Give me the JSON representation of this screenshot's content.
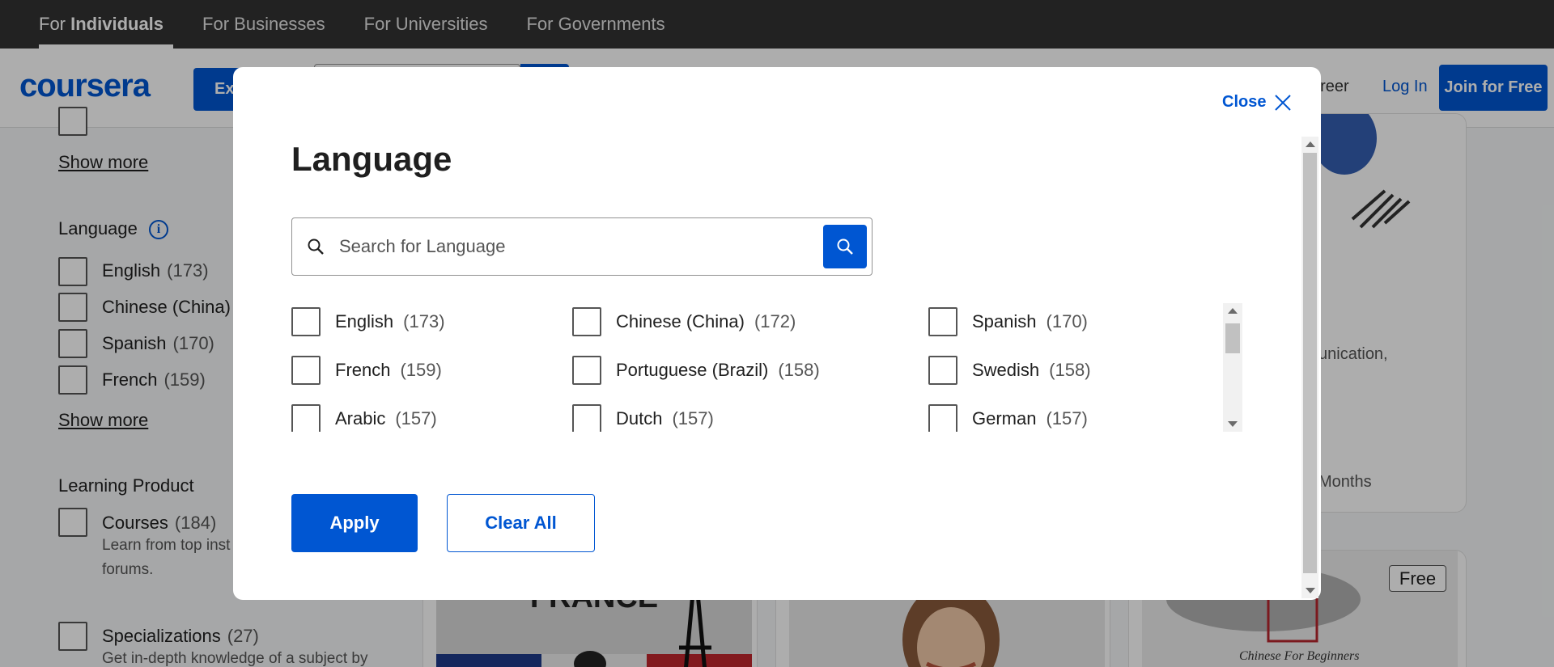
{
  "topbar": {
    "items": [
      {
        "prefix": "For ",
        "label": "Individuals"
      },
      {
        "label": "For Businesses"
      },
      {
        "label": "For Universities"
      },
      {
        "label": "For Governments"
      }
    ]
  },
  "header": {
    "logo": "coursera",
    "explore_label": "Ex",
    "career_label": "areer",
    "login_label": "Log In",
    "join_label": "Join for Free"
  },
  "filters": {
    "show_more_1": "Show more",
    "language_heading": "Language",
    "languages": [
      {
        "name": "English",
        "count": "(173)"
      },
      {
        "name": "Chinese (China)",
        "count": ""
      },
      {
        "name": "Spanish",
        "count": "(170)"
      },
      {
        "name": "French",
        "count": "(159)"
      }
    ],
    "show_more_2": "Show more",
    "learning_product_heading": "Learning Product",
    "products": [
      {
        "name": "Courses",
        "count": "(184)",
        "desc": "Learn from top inst assignments, video forums."
      },
      {
        "name": "Specializations",
        "count": "(27)",
        "desc": "Get in-depth knowledge of a subject by"
      }
    ]
  },
  "background": {
    "snippet_1": "unication,",
    "snippet_2": "Months",
    "free_badge": "Free",
    "card_image_text": "FRANCE",
    "calligraphy_caption": "Chinese For Beginners"
  },
  "modal": {
    "close_label": "Close",
    "title": "Language",
    "search_placeholder": "Search for Language",
    "languages": [
      {
        "name": "English",
        "count": "(173)"
      },
      {
        "name": "Chinese (China)",
        "count": "(172)"
      },
      {
        "name": "Spanish",
        "count": "(170)"
      },
      {
        "name": "French",
        "count": "(159)"
      },
      {
        "name": "Portuguese (Brazil)",
        "count": "(158)"
      },
      {
        "name": "Swedish",
        "count": "(158)"
      },
      {
        "name": "Arabic",
        "count": "(157)"
      },
      {
        "name": "Dutch",
        "count": "(157)"
      },
      {
        "name": "German",
        "count": "(157)"
      }
    ],
    "apply_label": "Apply",
    "clear_label": "Clear All"
  },
  "colors": {
    "brand_blue": "#0056d2",
    "topbar_bg": "#333333",
    "overlay": "rgba(0,0,0,0.32)"
  },
  "icons": [
    "search-icon",
    "close-icon",
    "info-icon"
  ]
}
